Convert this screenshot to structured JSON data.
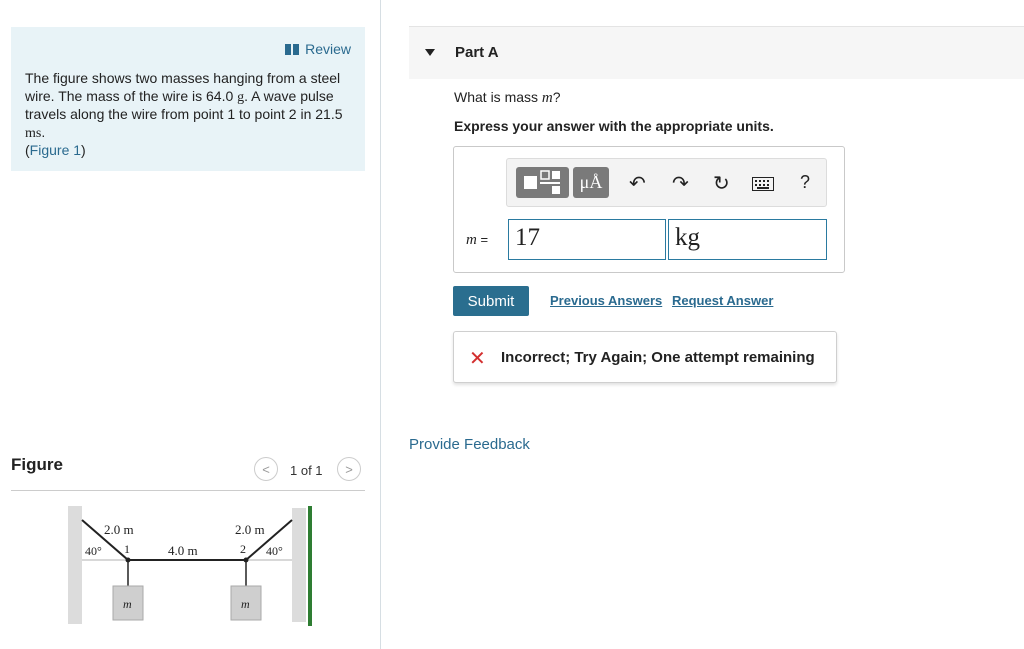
{
  "problem": {
    "review_label": "Review",
    "text": "The figure shows two masses hanging from a steel wire. The mass of the wire is 64.0",
    "unit_g": "g",
    "text2": ". A wave pulse travels along the wire from point 1 to point 2 in 21.5",
    "unit_ms": "ms",
    "text3": ".",
    "figure_link": "Figure 1"
  },
  "figure": {
    "title": "Figure",
    "pager": "1 of 1",
    "prev_icon": "chevron-left-icon",
    "next_icon": "chevron-right-icon",
    "labels": {
      "left_len": "2.0 m",
      "right_len": "2.0 m",
      "mid_len": "4.0 m",
      "left_angle": "40°",
      "right_angle": "40°",
      "point1": "1",
      "point2": "2",
      "mass_left": "m",
      "mass_right": "m"
    }
  },
  "partA": {
    "label": "Part A",
    "question_prefix": "What is mass",
    "question_var": "m",
    "question_suffix": "?",
    "instruction": "Express your answer with the appropriate units.",
    "toolbar": {
      "templates_icon": "templates-icon",
      "units_label": "μÅ",
      "undo_icon": "undo-icon",
      "redo_icon": "redo-icon",
      "reset_icon": "reset-icon",
      "keyboard_icon": "keyboard-icon",
      "help_label": "?"
    },
    "var_label": "m",
    "equals": "=",
    "value": "17",
    "unit": "kg",
    "submit_label": "Submit",
    "previous_answers": "Previous Answers",
    "request_answer": "Request Answer",
    "feedback_text": "Incorrect; Try Again; One attempt remaining",
    "provide_feedback": "Provide Feedback"
  },
  "colors": {
    "accent": "#2a6e8f",
    "problem_bg": "#e8f3f7",
    "error": "#d32f2f"
  }
}
